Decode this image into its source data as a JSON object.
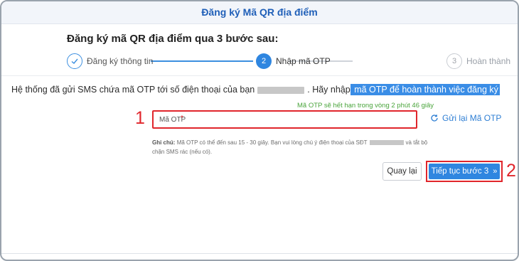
{
  "header": {
    "title": "Đăng ký Mã QR địa điểm"
  },
  "section_title": "Đăng ký mã QR địa điểm qua 3 bước sau:",
  "steps": [
    {
      "number": "",
      "label": "Đăng ký thông tin",
      "state": "done",
      "icon": "check-icon"
    },
    {
      "number": "2",
      "label": "Nhập mã OTP",
      "state": "active"
    },
    {
      "number": "3",
      "label": "Hoàn thành",
      "state": "pending"
    }
  ],
  "message": {
    "prefix": "Hệ thống đã gửi SMS chứa mã OTP tới số điện thoại của bạn",
    "middle": ". Hãy nhập",
    "highlight": " mã OTP để hoàn thành việc đăng ký"
  },
  "otp": {
    "expiry_note": "Mã OTP sẽ hết hạn trong vòng 2 phút 46 giây",
    "placeholder": "Mã OTP",
    "required_mark": "*",
    "resend_label": "Gửi lại Mã OTP"
  },
  "note": {
    "label": "Ghi chú:",
    "text_before": "Mã OTP có thể đến sau 15 - 30 giây. Bạn vui lòng chú ý điện thoại của SĐT",
    "text_after": "và tắt bộ chặn SMS rác (nếu có)."
  },
  "buttons": {
    "back": "Quay lại",
    "next": "Tiếp tục bước 3",
    "next_icon": "»"
  },
  "callouts": {
    "one": "1",
    "two": "2"
  },
  "colors": {
    "primary": "#2f86e0",
    "callout": "#e0262c",
    "expiry": "#49a43b",
    "header_text": "#1f5fb8"
  }
}
